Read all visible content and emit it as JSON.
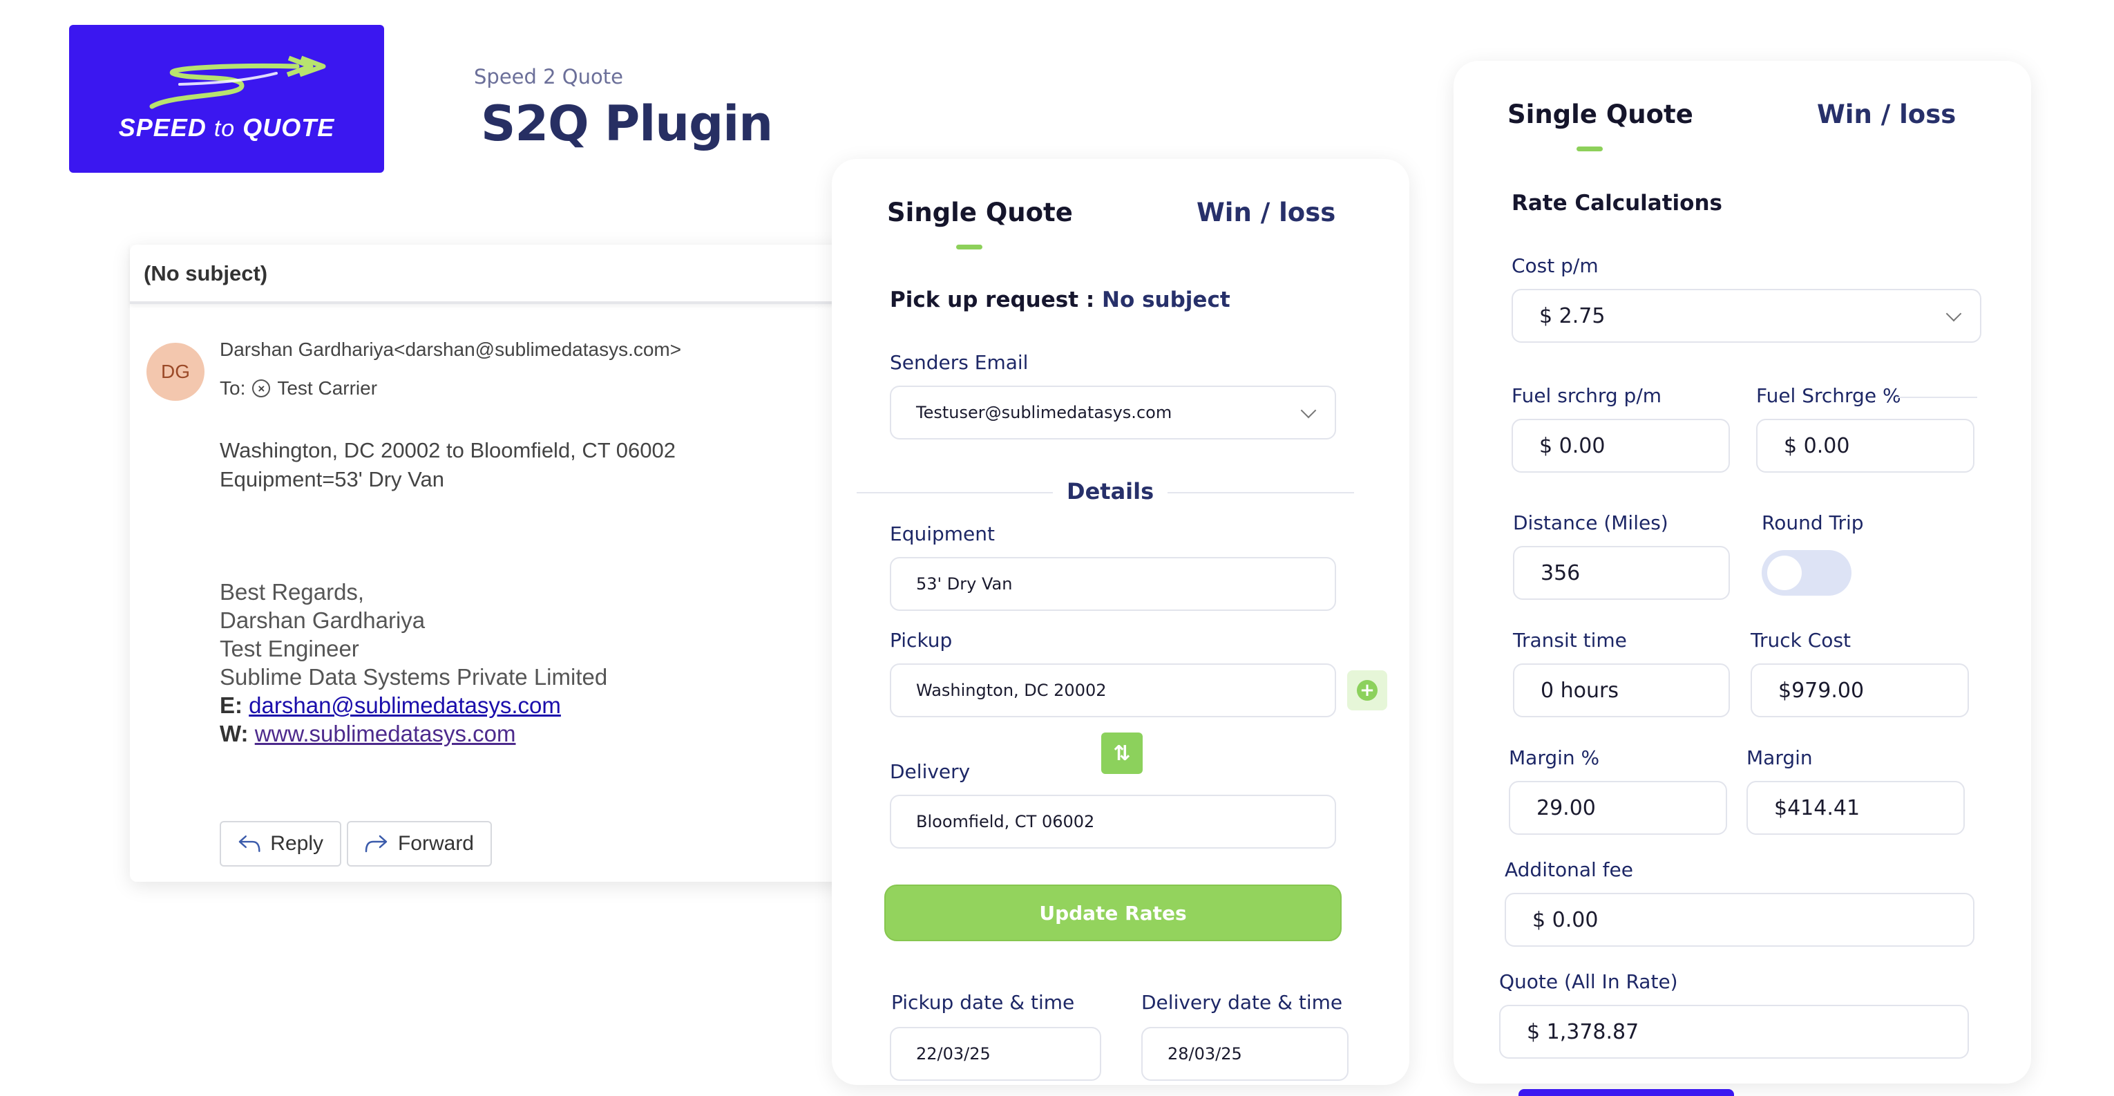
{
  "brand": {
    "logo_text_1": "SPEED",
    "logo_text_2": "to",
    "logo_text_3": "QUOTE",
    "subtitle": "Speed 2 Quote",
    "title": "S2Q Plugin",
    "accent_color": "#3b17f0",
    "green_color": "#8cd15c"
  },
  "email": {
    "subject": "(No subject)",
    "avatar": "DG",
    "sender": "Darshan Gardhariya<darshan@sublimedatasys.com>",
    "to_label": "To:",
    "to_icon": "remove-icon",
    "to_value": "Test Carrier",
    "body_line_1": "Washington, DC 20002 to Bloomfield, CT 06002",
    "body_line_2": "Equipment=53' Dry Van",
    "sig_1": "Best Regards,",
    "sig_2": "Darshan Gardhariya",
    "sig_3": "Test Engineer",
    "sig_4": "Sublime Data Systems Private Limited",
    "sig_email_label": "E:",
    "sig_email": "darshan@sublimedatasys.com",
    "sig_web_label": "W:",
    "sig_web": "www.sublimedatasys.com",
    "reply_label": "Reply",
    "forward_label": "Forward"
  },
  "quote_panel": {
    "tab_single": "Single Quote",
    "tab_winloss": "Win / loss",
    "pickup_request_label": "Pick up request :",
    "pickup_request_value": "No subject",
    "senders_email_label": "Senders Email",
    "senders_email_value": "Testuser@sublimedatasys.com",
    "details_label": "Details",
    "equipment_label": "Equipment",
    "equipment_value": "53' Dry Van",
    "pickup_label": "Pickup",
    "pickup_value": "Washington, DC 20002",
    "delivery_label": "Delivery",
    "delivery_value": "Bloomfield, CT 06002",
    "update_button": "Update Rates",
    "pickup_dt_label": "Pickup date & time",
    "pickup_dt_value": "22/03/25",
    "delivery_dt_label": "Delivery date & time",
    "delivery_dt_value": "28/03/25"
  },
  "rate_panel": {
    "tab_single": "Single Quote",
    "tab_winloss": "Win / loss",
    "section_title": "Rate Calculations",
    "cost_label": "Cost p/m",
    "cost_value": "$ 2.75",
    "fuel_pm_label": "Fuel srchrg p/m",
    "fuel_pm_value": "$ 0.00",
    "fuel_pct_label": "Fuel Srchrge %",
    "fuel_pct_value": "$ 0.00",
    "distance_label": "Distance (Miles)",
    "distance_value": "356",
    "round_trip_label": "Round Trip",
    "round_trip_on": false,
    "transit_label": "Transit time",
    "transit_value": "0 hours",
    "truck_cost_label": "Truck Cost",
    "truck_cost_value": "$979.00",
    "margin_pct_label": "Margin %",
    "margin_pct_value": "29.00",
    "margin_label": "Margin",
    "margin_value": "$414.41",
    "additional_fee_label": "Additonal fee",
    "additional_fee_value": "$ 0.00",
    "quote_label": "Quote (All In Rate)",
    "quote_value": "$ 1,378.87"
  }
}
